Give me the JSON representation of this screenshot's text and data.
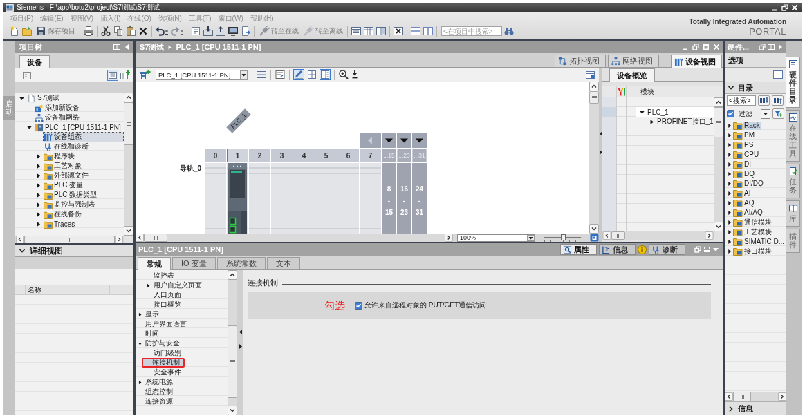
{
  "window": {
    "title": "Siemens  -  F:\\app\\botu2\\project\\S7测试\\S7测试"
  },
  "menu": [
    "项目(P)",
    "编辑(E)",
    "视图(V)",
    "插入(I)",
    "在线(O)",
    "选项(N)",
    "工具(T)",
    "窗口(W)",
    "帮助(H)"
  ],
  "toolbar": {
    "buttons": [
      "保存项目",
      "转至在线",
      "转至离线"
    ],
    "search": {
      "placeholder": "<在项目中搜索>"
    }
  },
  "brand": {
    "line_1": "Totally Integrated Automation",
    "line_2": "PORTAL"
  },
  "start_tab": {
    "label": "启动"
  },
  "project_tree": {
    "title": "项目树",
    "tab": "设备",
    "items": [
      {
        "label": "S7测试",
        "kind": "project",
        "expanded": true,
        "selected": false,
        "children": [
          {
            "label": "添加新设备",
            "kind": "add-device",
            "selected": false
          },
          {
            "label": "设备和网络",
            "kind": "network",
            "selected": false
          },
          {
            "label": "PLC_1 [CPU 1511-1 PN]",
            "kind": "plc",
            "expanded": true,
            "selected": false,
            "children": [
              {
                "label": "设备组态",
                "kind": "device-config",
                "selected": true
              },
              {
                "label": "在线和诊断",
                "kind": "diagnostics",
                "selected": false
              },
              {
                "label": "程序块",
                "kind": "folder",
                "expanded": false,
                "selected": false
              },
              {
                "label": "工艺对象",
                "kind": "folder",
                "expanded": false,
                "selected": false
              },
              {
                "label": "外部源文件",
                "kind": "folder",
                "expanded": false,
                "selected": false
              },
              {
                "label": "PLC 变量",
                "kind": "folder",
                "expanded": false,
                "selected": false
              },
              {
                "label": "PLC 数据类型",
                "kind": "folder",
                "expanded": false,
                "selected": false
              },
              {
                "label": "监控与强制表",
                "kind": "folder",
                "expanded": false,
                "selected": false
              },
              {
                "label": "在线备份",
                "kind": "folder",
                "expanded": false,
                "selected": false
              },
              {
                "label": "Traces",
                "kind": "folder",
                "expanded": false,
                "selected": false
              }
            ]
          }
        ]
      }
    ],
    "detail_view": {
      "title": "详细视图",
      "expanded": true,
      "columns": [
        "名称"
      ]
    }
  },
  "editor": {
    "breadcrumb": [
      "S7测试",
      "PLC_1 [CPU 1511-1 PN]"
    ],
    "view_tabs": [
      {
        "label": "拓扑视图",
        "selected": false
      },
      {
        "label": "网络视图",
        "selected": false
      },
      {
        "label": "设备视图",
        "selected": true
      }
    ],
    "device_select": "PLC_1 [CPU 1511-1 PN]",
    "tools": [
      {
        "selected": false
      },
      {
        "selected": false
      },
      {
        "selected": true
      },
      {
        "selected": false
      },
      {
        "selected": true
      }
    ],
    "rack": {
      "device_label": "PLC_1",
      "rail_label": "导轨_0",
      "slots": [
        {
          "label": "0",
          "selected": false,
          "occupied": false
        },
        {
          "label": "1",
          "selected": true,
          "occupied": true
        },
        {
          "label": "2",
          "selected": false,
          "occupied": false
        },
        {
          "label": "3",
          "selected": false,
          "occupied": false
        },
        {
          "label": "4",
          "selected": false,
          "occupied": false
        },
        {
          "label": "5",
          "selected": false,
          "occupied": false
        },
        {
          "label": "6",
          "selected": false,
          "occupied": false
        },
        {
          "label": "7",
          "selected": false,
          "occupied": false
        }
      ],
      "expansions": [
        {
          "label": "...15",
          "range": [
            "8",
            "-",
            "15"
          ]
        },
        {
          "label": "...23",
          "range": [
            "16",
            "-",
            "23"
          ]
        },
        {
          "label": "...31",
          "range": [
            "24",
            "-",
            "31"
          ]
        }
      ]
    },
    "zoom": {
      "value": "100%",
      "level": 0.5
    }
  },
  "device_overview": {
    "tab": "设备概览",
    "columns": [
      "...",
      "模块"
    ],
    "rows": [
      {
        "module": "PLC_1",
        "selected": true,
        "expanded": true,
        "children": [
          {
            "module": "PROFINET接口_1",
            "selected": false,
            "expanded": false
          }
        ]
      }
    ]
  },
  "properties": {
    "title": "PLC_1 [CPU 1511-1 PN]",
    "inspector_tabs": [
      {
        "label": "属性",
        "selected": true
      },
      {
        "label": "信息",
        "selected": false
      },
      {
        "label": "诊断",
        "selected": false
      }
    ],
    "tabs": [
      {
        "label": "常规",
        "selected": true
      },
      {
        "label": "IO 变量",
        "selected": false
      },
      {
        "label": "系统常数",
        "selected": false
      },
      {
        "label": "文本",
        "selected": false
      }
    ],
    "nav": [
      {
        "children": [
          {
            "label": "监控表",
            "selected": false,
            "highlighted": false
          },
          {
            "label": "用户自定义页面",
            "expanded": false,
            "selected": false,
            "highlighted": false
          },
          {
            "label": "入口页面",
            "selected": false,
            "highlighted": false
          },
          {
            "label": "接口概览",
            "selected": false,
            "highlighted": false
          }
        ]
      },
      {
        "label": "显示",
        "expanded": false,
        "selected": false,
        "highlighted": false
      },
      {
        "label": "用户界面语言",
        "selected": false,
        "highlighted": false
      },
      {
        "label": "时间",
        "selected": false,
        "highlighted": false
      },
      {
        "label": "防护与安全",
        "expanded": true,
        "selected": false,
        "highlighted": false,
        "children": [
          {
            "label": "访问级别",
            "selected": false,
            "highlighted": false
          },
          {
            "label": "连接机制",
            "selected": true,
            "highlighted": true
          },
          {
            "label": "安全事件",
            "selected": false,
            "highlighted": false
          }
        ]
      },
      {
        "label": "系统电源",
        "expanded": false,
        "selected": false,
        "highlighted": false
      },
      {
        "label": "组态控制",
        "selected": false,
        "highlighted": false
      },
      {
        "label": "连接资源",
        "selected": false,
        "highlighted": false
      }
    ],
    "section": {
      "title": "连接机制",
      "annotation": "勾选",
      "option": {
        "label": "允许来自远程对象的 PUT/GET通信访问",
        "checked": true
      }
    }
  },
  "task_card": {
    "title": "硬件...",
    "pane_title": "选项",
    "catalog": {
      "title": "目录",
      "expanded": true,
      "search": {
        "placeholder": "<搜索>"
      },
      "filter": {
        "label": "过滤",
        "checked": true
      },
      "items": [
        {
          "label": "Rack",
          "selected": true,
          "expanded": false
        },
        {
          "label": "PM",
          "selected": false,
          "expanded": false
        },
        {
          "label": "PS",
          "selected": false,
          "expanded": false
        },
        {
          "label": "CPU",
          "selected": false,
          "expanded": false
        },
        {
          "label": "DI",
          "selected": false,
          "expanded": false
        },
        {
          "label": "DQ",
          "selected": false,
          "expanded": false
        },
        {
          "label": "DI/DQ",
          "selected": false,
          "expanded": false
        },
        {
          "label": "AI",
          "selected": false,
          "expanded": false
        },
        {
          "label": "AQ",
          "selected": false,
          "expanded": false
        },
        {
          "label": "AI/AQ",
          "selected": false,
          "expanded": false
        },
        {
          "label": "通信模块",
          "selected": false,
          "expanded": false
        },
        {
          "label": "工艺模块",
          "selected": false,
          "expanded": false
        },
        {
          "label": "SIMATIC D...",
          "selected": false,
          "expanded": false
        },
        {
          "label": "接口模块",
          "selected": false,
          "expanded": false
        }
      ]
    },
    "info": {
      "title": "信息",
      "expanded": false
    }
  },
  "side_tabs": [
    {
      "label": "硬件目录",
      "selected": true
    },
    {
      "label": "在线工具",
      "selected": false
    },
    {
      "label": "任务",
      "selected": false
    },
    {
      "label": "库",
      "selected": false
    },
    {
      "label": "插件",
      "selected": false
    }
  ]
}
